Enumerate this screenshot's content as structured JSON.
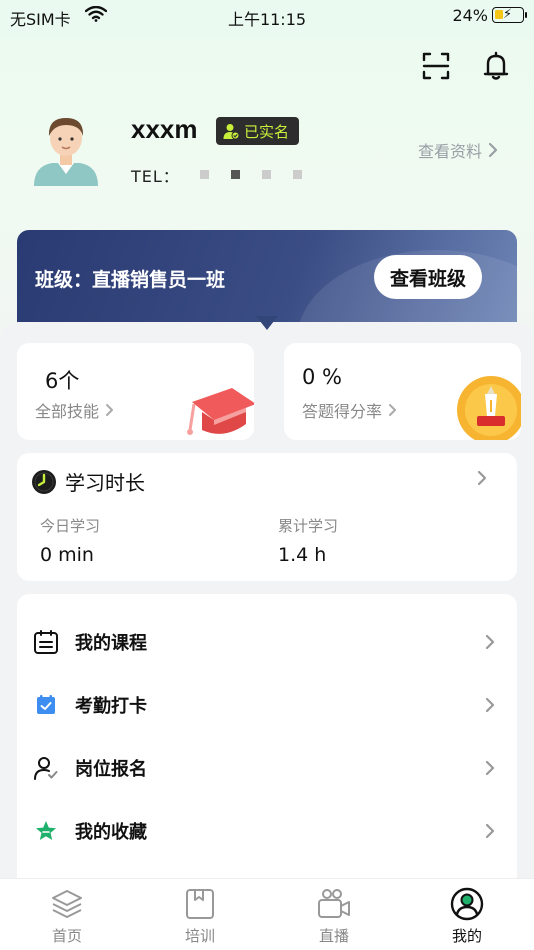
{
  "status_bar": {
    "carrier": "无SIM卡",
    "time": "上午11:15",
    "battery": "24%"
  },
  "header": {
    "scan_icon": "scan-icon",
    "bell_icon": "bell-icon"
  },
  "profile": {
    "username": "xxxm",
    "verified_badge": "已实名",
    "tel_label": "TEL：",
    "view_profile": "查看资料"
  },
  "class_banner": {
    "label": "班级：直播销售员一班",
    "button": "查看班级"
  },
  "stats": {
    "skills_value": "6个",
    "skills_label": "全部技能",
    "rate_value": "0 %",
    "rate_label": "答题得分率"
  },
  "study": {
    "title": "学习时长",
    "today_label": "今日学习",
    "today_value": "0 min",
    "total_label": "累计学习",
    "total_value": "1.4 h"
  },
  "menu": {
    "items": [
      {
        "label": "我的课程",
        "icon": "calendar-icon"
      },
      {
        "label": "考勤打卡",
        "icon": "check-calendar-icon"
      },
      {
        "label": "岗位报名",
        "icon": "user-check-icon"
      },
      {
        "label": "我的收藏",
        "icon": "star-icon"
      }
    ]
  },
  "tabbar": {
    "tabs": [
      {
        "label": "首页",
        "icon": "layers-icon"
      },
      {
        "label": "培训",
        "icon": "book-icon"
      },
      {
        "label": "直播",
        "icon": "camera-icon"
      },
      {
        "label": "我的",
        "icon": "user-circle-icon"
      }
    ]
  },
  "colors": {
    "banner": "#2a3a72",
    "verified_text": "#c8f03a",
    "accent_green": "#1fb06b"
  }
}
